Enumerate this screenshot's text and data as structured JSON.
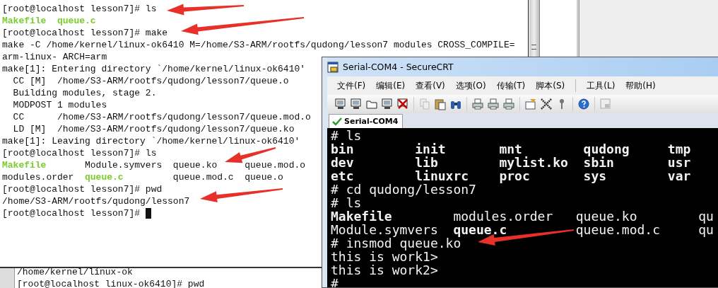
{
  "left_terminal": {
    "lines": [
      {
        "kind": "text",
        "text": "[root@localhost lesson7]# ls"
      },
      {
        "kind": "listing",
        "rows": [
          [
            {
              "text": "Makefile",
              "highlighted": true
            },
            {
              "text": "queue.c",
              "highlighted": true
            }
          ]
        ]
      },
      {
        "kind": "text",
        "text": "[root@localhost lesson7]# make"
      },
      {
        "kind": "text",
        "text": "make -C /home/kernel/linux-ok6410 M=/home/S3-ARM/rootfs/qudong/lesson7 modules CROSS_COMPILE="
      },
      {
        "kind": "text",
        "text": "arm-linux- ARCH=arm"
      },
      {
        "kind": "text",
        "text": "make[1]: Entering directory `/home/kernel/linux-ok6410'"
      },
      {
        "kind": "text",
        "text": "  CC [M]  /home/S3-ARM/rootfs/qudong/lesson7/queue.o"
      },
      {
        "kind": "text",
        "text": "  Building modules, stage 2."
      },
      {
        "kind": "text",
        "text": "  MODPOST 1 modules"
      },
      {
        "kind": "text",
        "text": "  CC      /home/S3-ARM/rootfs/qudong/lesson7/queue.mod.o"
      },
      {
        "kind": "text",
        "text": "  LD [M]  /home/S3-ARM/rootfs/qudong/lesson7/queue.ko"
      },
      {
        "kind": "text",
        "text": "make[1]: Leaving directory `/home/kernel/linux-ok6410'"
      },
      {
        "kind": "text",
        "text": "[root@localhost lesson7]# ls"
      },
      {
        "kind": "listing",
        "rows": [
          [
            {
              "text": "Makefile",
              "highlighted": true
            },
            {
              "text": "Module.symvers",
              "highlighted": false
            },
            {
              "text": "queue.ko",
              "highlighted": false
            },
            {
              "text": "queue.mod.o",
              "highlighted": false
            }
          ],
          [
            {
              "text": "modules.order",
              "highlighted": false
            },
            {
              "text": "queue.c",
              "highlighted": true
            },
            {
              "text": "queue.mod.c",
              "highlighted": false
            },
            {
              "text": "queue.o",
              "highlighted": false
            }
          ]
        ]
      },
      {
        "kind": "text",
        "text": "[root@localhost lesson7]# pwd"
      },
      {
        "kind": "text",
        "text": "/home/S3-ARM/rootfs/qudong/lesson7"
      },
      {
        "kind": "text",
        "text": "[root@localhost lesson7]#",
        "cursor": true
      }
    ]
  },
  "bottom_terminal": {
    "lines": [
      {
        "kind": "text",
        "text": "/home/kernel/linux-ok"
      },
      {
        "kind": "text",
        "text": "[root@localhost linux-ok6410]# pwd"
      }
    ]
  },
  "securecrt": {
    "title": "Serial-COM4 - SecureCRT",
    "menu": [
      {
        "label": "文件(F)"
      },
      {
        "label": "编辑(E)"
      },
      {
        "label": "查看(V)"
      },
      {
        "label": "选项(O)"
      },
      {
        "label": "传输(T)"
      },
      {
        "label": "脚本(S)"
      },
      {
        "label": "工具(L)"
      },
      {
        "label": "帮助(H)"
      }
    ],
    "tabs": [
      {
        "label": "Serial-COM4",
        "selected": true
      }
    ],
    "lines": [
      {
        "kind": "text",
        "text": "# ls"
      },
      {
        "kind": "listing",
        "rows": [
          [
            {
              "text": "bin",
              "highlighted": true
            },
            {
              "text": "init",
              "highlighted": true
            },
            {
              "text": "mnt",
              "highlighted": true
            },
            {
              "text": "qudong",
              "highlighted": true
            },
            {
              "text": "tmp",
              "highlighted": true
            }
          ],
          [
            {
              "text": "dev",
              "highlighted": true
            },
            {
              "text": "lib",
              "highlighted": true
            },
            {
              "text": "mylist.ko",
              "highlighted": true
            },
            {
              "text": "sbin",
              "highlighted": true
            },
            {
              "text": "usr",
              "highlighted": true
            }
          ],
          [
            {
              "text": "etc",
              "highlighted": true
            },
            {
              "text": "linuxrc",
              "highlighted": true
            },
            {
              "text": "proc",
              "highlighted": true
            },
            {
              "text": "sys",
              "highlighted": true
            },
            {
              "text": "var",
              "highlighted": true
            }
          ]
        ]
      },
      {
        "kind": "text",
        "text": "# cd qudong/lesson7"
      },
      {
        "kind": "text",
        "text": "# ls"
      },
      {
        "kind": "listing",
        "rows": [
          [
            {
              "text": "Makefile",
              "highlighted": true
            },
            {
              "text": "modules.order",
              "highlighted": false
            },
            {
              "text": "queue.ko",
              "highlighted": false
            },
            {
              "text": "qu",
              "highlighted": false
            }
          ],
          [
            {
              "text": "Module.symvers",
              "highlighted": false
            },
            {
              "text": "queue.c",
              "highlighted": true
            },
            {
              "text": "queue.mod.c",
              "highlighted": false
            },
            {
              "text": "qu",
              "highlighted": false
            }
          ]
        ]
      },
      {
        "kind": "text",
        "text": "# insmod queue.ko"
      },
      {
        "kind": "text",
        "text": "this is work1>"
      },
      {
        "kind": "text",
        "text": "this is work2>"
      },
      {
        "kind": "text",
        "text": "#"
      }
    ]
  }
}
